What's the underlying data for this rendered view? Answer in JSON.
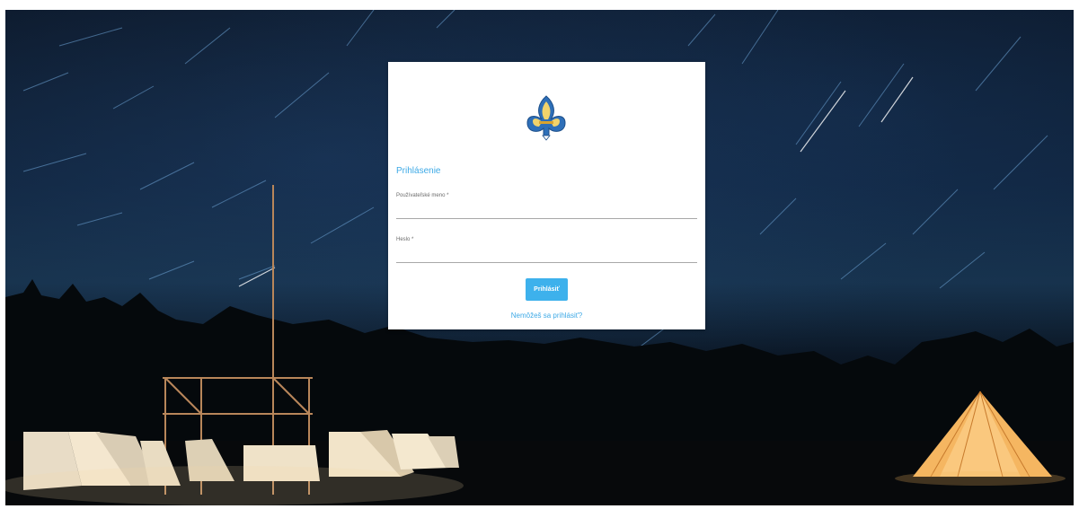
{
  "background": {
    "scene": "night-camp-star-trails",
    "colors": {
      "sky": "#0f223a",
      "tent_glow": "#f4d9a4",
      "teepee_glow": "#f5b661"
    }
  },
  "login": {
    "logo_icon": "scout-fleur-de-lis-logo",
    "title": "Prihlásenie",
    "username_label": "Používateľské meno *",
    "username_value": "",
    "password_label": "Heslo *",
    "password_value": "",
    "submit_label": "Prihlásiť",
    "forgot_label": "Nemôžeš sa prihlásiť?",
    "accent_color": "#3da9e6",
    "button_color": "#3db1ec"
  }
}
